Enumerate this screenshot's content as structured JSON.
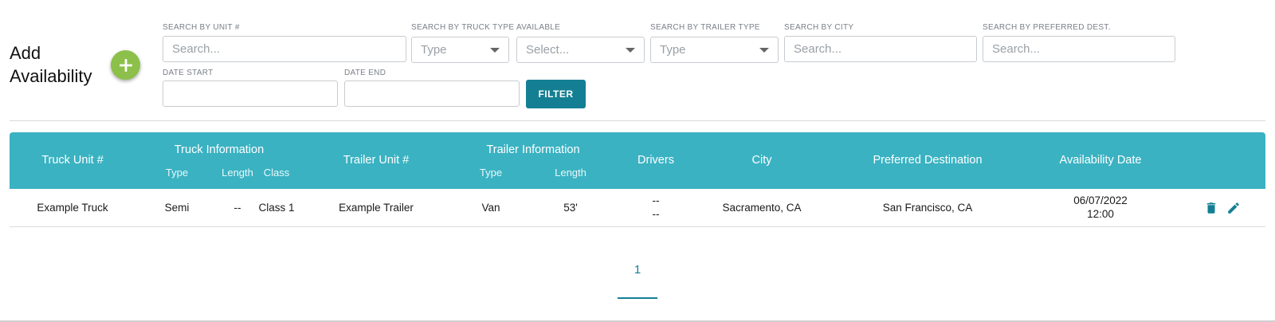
{
  "header": {
    "title_line1": "Add",
    "title_line2": "Availability",
    "add_icon": "plus-icon",
    "add_color": "#8cc04a"
  },
  "filters": {
    "unit": {
      "label": "SEARCH BY UNIT #",
      "placeholder": "Search..."
    },
    "truck_type": {
      "label": "SEARCH BY TRUCK TYPE",
      "placeholder": "Type"
    },
    "available": {
      "label": "AVAILABLE",
      "placeholder": "Select..."
    },
    "trailer_type": {
      "label": "SEARCH BY TRAILER TYPE",
      "placeholder": "Type"
    },
    "city": {
      "label": "SEARCH BY CITY",
      "placeholder": "Search..."
    },
    "pref_dest": {
      "label": "SEARCH BY PREFERRED DEST.",
      "placeholder": "Search..."
    },
    "date_start": {
      "label": "DATE START",
      "value": ""
    },
    "date_end": {
      "label": "DATE END",
      "value": ""
    },
    "filter_button": "FILTER"
  },
  "table": {
    "header_color": "#3ab2c2",
    "columns": {
      "truck_unit": "Truck Unit #",
      "truck_info": "Truck Information",
      "truck_type": "Type",
      "truck_length": "Length",
      "truck_class": "Class",
      "trailer_unit": "Trailer Unit #",
      "trailer_info": "Trailer Information",
      "trailer_type": "Type",
      "trailer_length": "Length",
      "drivers": "Drivers",
      "city": "City",
      "pref_dest": "Preferred Destination",
      "avail_date": "Availability Date"
    },
    "rows": [
      {
        "truck_unit": "Example Truck",
        "truck_type": "Semi",
        "truck_length": "--",
        "truck_class": "Class 1",
        "trailer_unit": "Example Trailer",
        "trailer_type": "Van",
        "trailer_length": "53'",
        "driver1": "--",
        "driver2": "--",
        "city": "Sacramento, CA",
        "pref_dest": "San Francisco, CA",
        "date": "06/07/2022",
        "time": "12:00",
        "delete_icon": "trash-icon",
        "edit_icon": "pencil-icon"
      }
    ]
  },
  "pagination": {
    "current": "1"
  },
  "colors": {
    "accent": "#147f93"
  }
}
